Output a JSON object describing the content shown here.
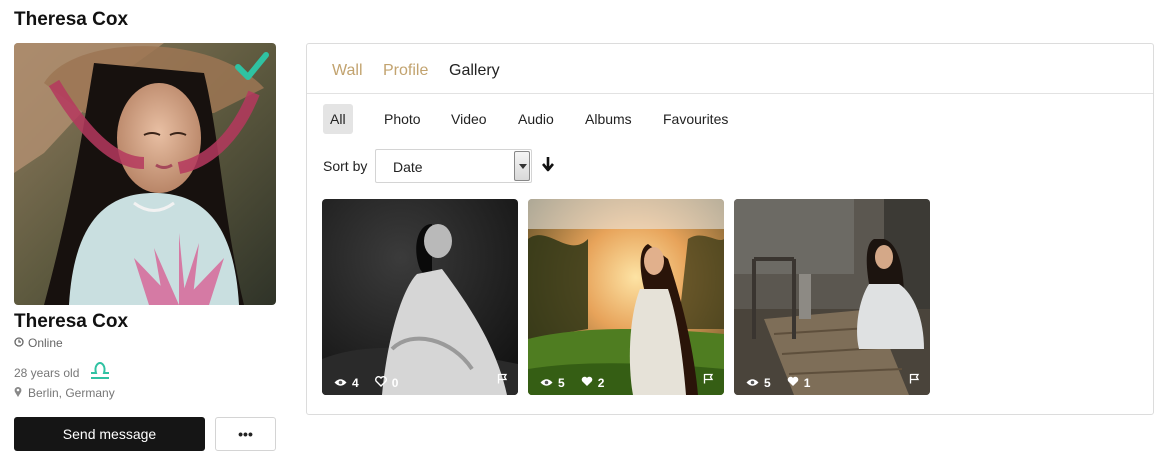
{
  "user": {
    "name": "Theresa Cox",
    "status": "Online",
    "age": "28 years old",
    "zodiac_icon": "libra-icon",
    "location": "Berlin, Germany"
  },
  "actions": {
    "send_message": "Send message",
    "more": "•••"
  },
  "tabs": [
    {
      "label": "Wall"
    },
    {
      "label": "Profile"
    },
    {
      "label": "Gallery",
      "active": true
    }
  ],
  "filters": [
    {
      "label": "All",
      "active": true
    },
    {
      "label": "Photo"
    },
    {
      "label": "Video"
    },
    {
      "label": "Audio"
    },
    {
      "label": "Albums"
    },
    {
      "label": "Favourites"
    }
  ],
  "sort": {
    "label": "Sort by",
    "value": "Date"
  },
  "photos": [
    {
      "views": "4",
      "likes": "0",
      "liked": false
    },
    {
      "views": "5",
      "likes": "2",
      "liked": true
    },
    {
      "views": "5",
      "likes": "1",
      "liked": true
    }
  ],
  "colors": {
    "accent_tab": "#c2a36f",
    "verified": "#2fc2a2",
    "button_dark": "#151515"
  }
}
